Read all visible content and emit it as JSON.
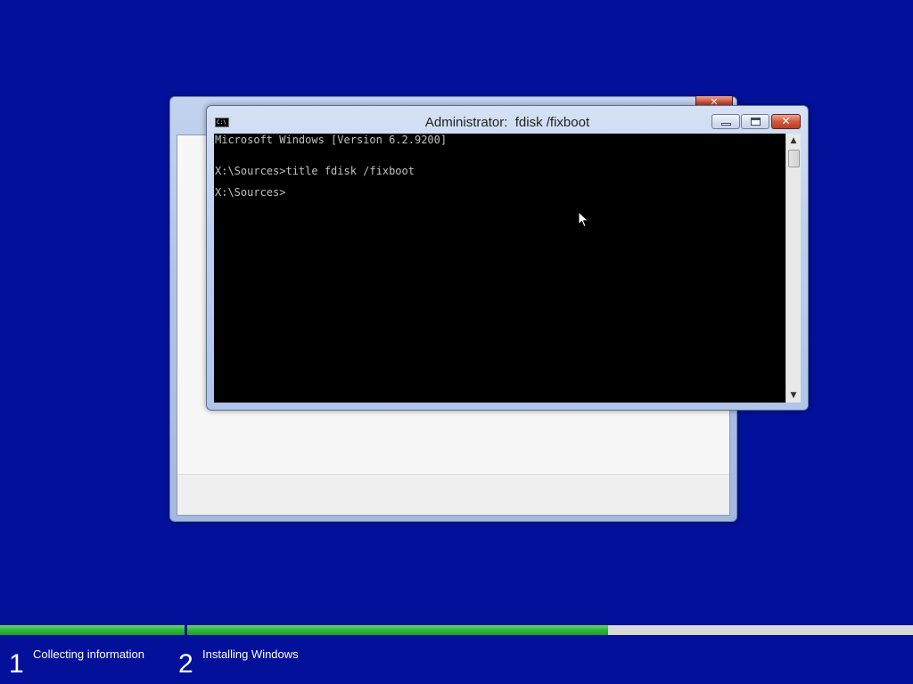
{
  "background_color": "#03119a",
  "setup_window": {
    "close_glyph": "✕"
  },
  "cmd_window": {
    "icon_text": "C:\\",
    "title": "Administrator:  fdisk /fixboot",
    "buttons": {
      "minimize_icon": "minimize-icon",
      "maximize_icon": "maximize-icon",
      "close_glyph": "✕"
    },
    "console_lines": [
      "Microsoft Windows [Version 6.2.9200]",
      "",
      "X:\\Sources>title fdisk /fixboot",
      "",
      "X:\\Sources>"
    ],
    "scrollbar": {
      "up_glyph": "▲",
      "down_glyph": "▼"
    }
  },
  "progress": {
    "steps": [
      {
        "number": "1",
        "label": "Collecting information",
        "fill_fraction": 1.0
      },
      {
        "number": "2",
        "label": "Installing Windows",
        "fill_fraction": 0.58
      }
    ],
    "fill_color": "#2db53a",
    "track_color": "#d8d8d8"
  }
}
